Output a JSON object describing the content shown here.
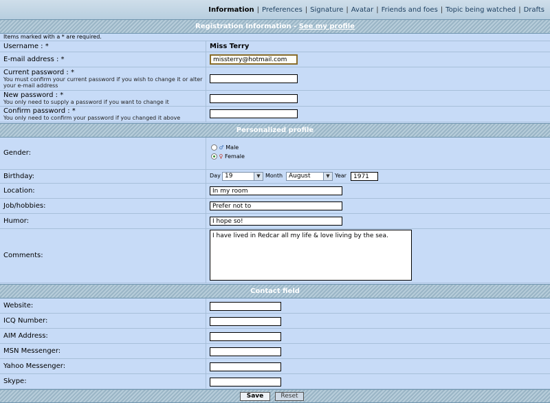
{
  "nav": {
    "items": [
      "Information",
      "Preferences",
      "Signature",
      "Avatar",
      "Friends and foes",
      "Topic being watched",
      "Drafts"
    ],
    "active": "Information"
  },
  "registration": {
    "header_title": "Registration Information - ",
    "header_link": "See my profile",
    "required_note": "Items marked with a * are required.",
    "username_label": "Username : *",
    "username_value": "Miss Terry",
    "email_label": "E-mail address : *",
    "email_value": "missterry@hotmail.com",
    "current_password_label": "Current password : *",
    "current_password_hint": "You must confirm your current password if you wish to change it or alter your e-mail address",
    "new_password_label": "New password : *",
    "new_password_hint": "You only need to supply a password if you want to change it",
    "confirm_password_label": "Confirm password : *",
    "confirm_password_hint": "You only need to confirm your password if you changed it above"
  },
  "profile": {
    "header_title": "Personalized profile",
    "gender_label": "Gender:",
    "gender_male": "Male",
    "gender_female": "Female",
    "gender_selected": "Female",
    "birthday_label": "Birthday:",
    "day_label": "Day",
    "day_value": "19",
    "month_label": "Month",
    "month_value": "August",
    "year_label": "Year",
    "year_value": "1971",
    "location_label": "Location:",
    "location_value": "In my room",
    "job_label": "Job/hobbies:",
    "job_value": "Prefer not to",
    "humor_label": "Humor:",
    "humor_value": "I hope so!",
    "comments_label": "Comments:",
    "comments_value": "I have lived in Redcar all my life & love living by the sea."
  },
  "contact": {
    "header_title": "Contact field",
    "website_label": "Website:",
    "icq_label": "ICQ Number:",
    "aim_label": "AIM Address:",
    "msn_label": "MSN Messenger:",
    "yahoo_label": "Yahoo Messenger:",
    "skype_label": "Skype:"
  },
  "actions": {
    "save_label": "Save",
    "reset_label": "Reset"
  },
  "colors": {
    "male_symbol": "#3b6fb5",
    "female_symbol": "#c0392b"
  }
}
